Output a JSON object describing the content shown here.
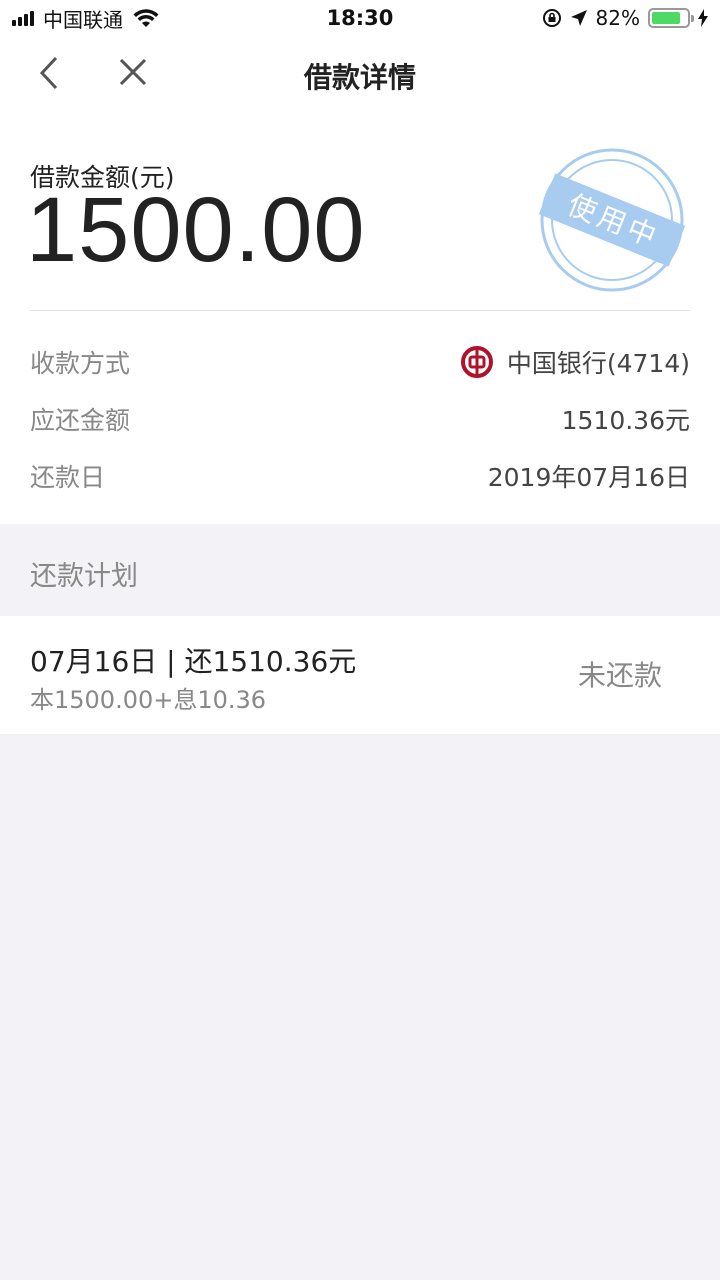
{
  "status_bar": {
    "carrier": "中国联通",
    "time": "18:30",
    "battery_percent": "82%",
    "battery_level": 0.82,
    "battery_color": "#4cd964"
  },
  "nav": {
    "title": "借款详情",
    "back_icon": "chevron-left-icon",
    "close_icon": "close-icon"
  },
  "loan": {
    "amount_label": "借款金额(元)",
    "amount_value": "1500.00",
    "stamp_text": "使用中",
    "stamp_color": "#a8ccef"
  },
  "details": [
    {
      "label": "收款方式",
      "value": "中国银行(4714)",
      "icon": "bank-of-china-logo"
    },
    {
      "label": "应还金额",
      "value": "1510.36元"
    },
    {
      "label": "还款日",
      "value": "2019年07月16日"
    }
  ],
  "plan": {
    "section_title": "还款计划",
    "items": [
      {
        "title": "07月16日 | 还1510.36元",
        "breakdown": "本1500.00+息10.36",
        "status": "未还款"
      }
    ]
  },
  "colors": {
    "background": "#f3f3f7",
    "bank_red": "#b0112b",
    "label_gray": "#888888"
  }
}
